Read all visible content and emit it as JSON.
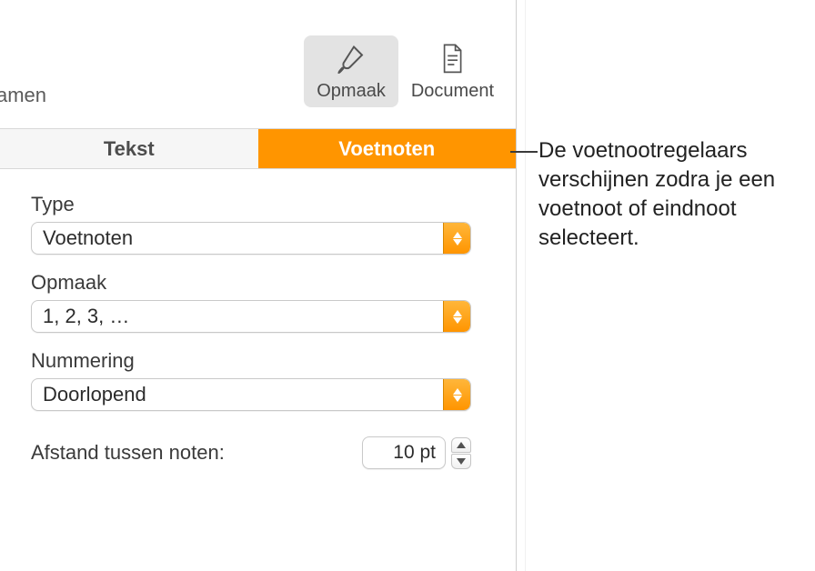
{
  "toolbar": {
    "left_truncated_label": "amen",
    "format_label": "Opmaak",
    "document_label": "Document"
  },
  "tabs": {
    "text": "Tekst",
    "footnotes": "Voetnoten"
  },
  "fields": {
    "type_label": "Type",
    "type_value": "Voetnoten",
    "format_label": "Opmaak",
    "format_value": "1, 2, 3, …",
    "numbering_label": "Nummering",
    "numbering_value": "Doorlopend",
    "spacing_label": "Afstand tussen noten:",
    "spacing_value": "10 pt"
  },
  "annotation": "De voetnootregelaars verschijnen zodra je een voetnoot of eindnoot selecteert.",
  "colors": {
    "accent": "#ff9500"
  }
}
